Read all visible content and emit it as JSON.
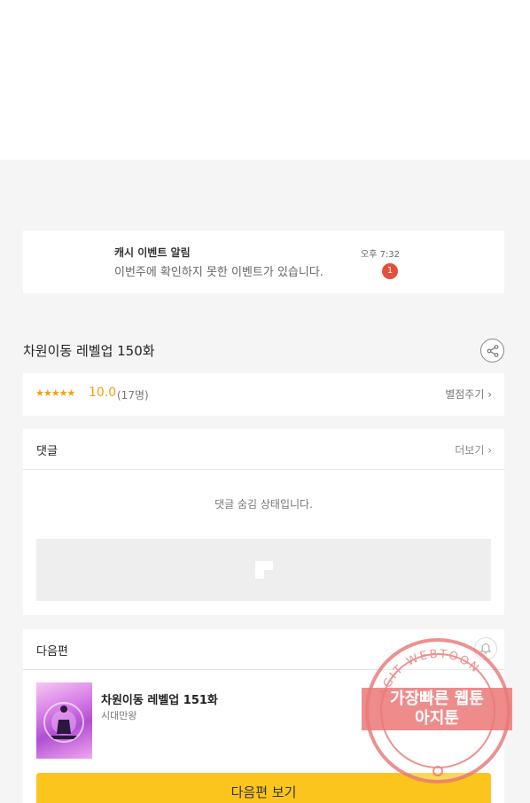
{
  "notification": {
    "title": "캐시 이벤트 알림",
    "body": "이번주에 확인하지 못한 이벤트가 있습니다.",
    "time": "오후 7:32",
    "badge": "1"
  },
  "episode": {
    "title": "차원이동 레벨업 150화",
    "share_icon": "share-icon"
  },
  "rating": {
    "stars": "★★★★★",
    "score": "10.0",
    "count": "(17명)",
    "rate_label": "별점주기 ›"
  },
  "comments": {
    "title": "댓글",
    "more_label": "더보기 ›",
    "hidden_message": "댓글 숨김 상태입니다."
  },
  "next_episode": {
    "section_title": "다음편",
    "title": "차원이동 레벨업 151화",
    "author": "시대만왕",
    "button_label": "다음편 보기"
  },
  "watermark": {
    "line1": "가장빠른 웹툰",
    "line2": "아지툰",
    "ring_text": "AGIT WEBTOON"
  },
  "colors": {
    "accent_yellow": "#fcc51d",
    "badge_red": "#e2513a",
    "star_orange": "#f0a010"
  }
}
